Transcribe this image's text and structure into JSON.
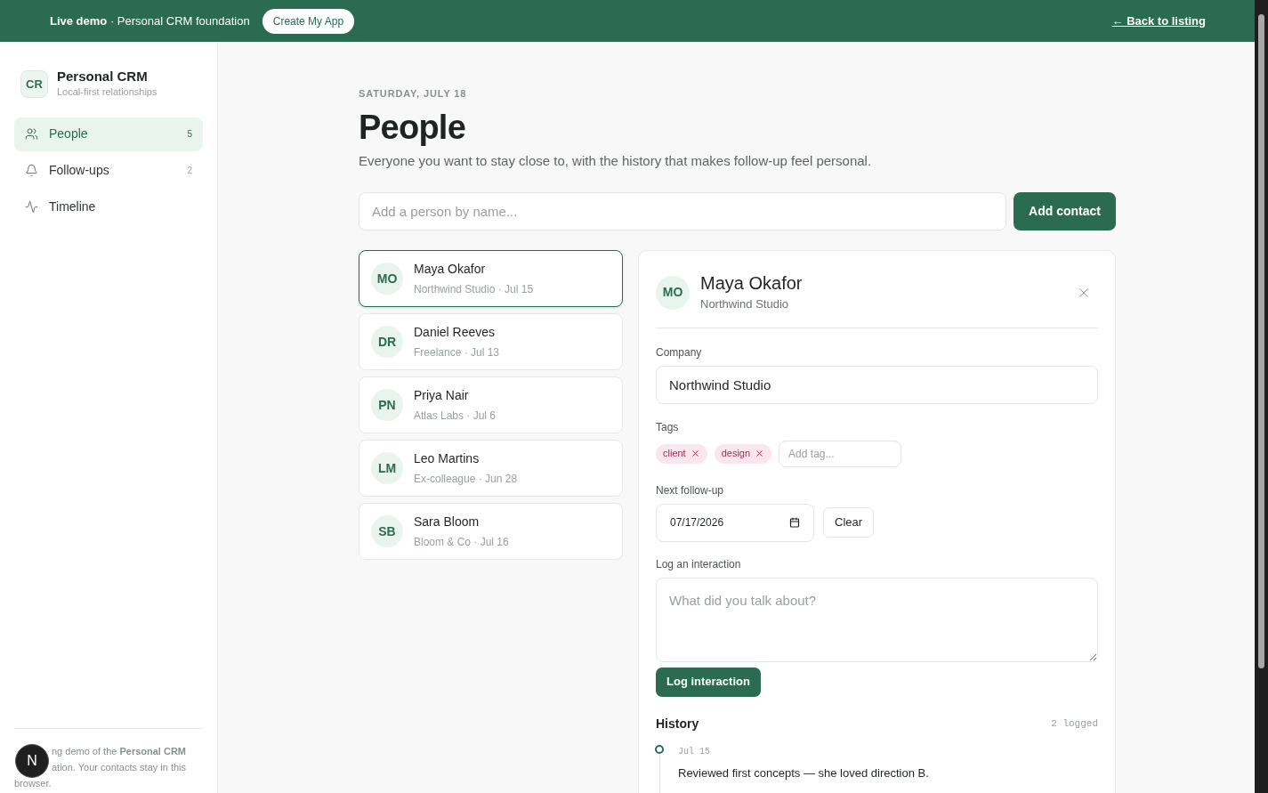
{
  "banner": {
    "text": "**Live demo** · Personal CRM foundation",
    "cta": "Create My App",
    "back_link": "← Back to listing"
  },
  "sidebar": {
    "logo": "CR",
    "title": "Personal CRM",
    "subtitle": "Local-first relationships",
    "items": [
      {
        "label": "People",
        "count": "5",
        "kind": "people",
        "selected": true
      },
      {
        "label": "Follow-ups",
        "count": "2",
        "kind": "bell",
        "selected": false
      },
      {
        "label": "Timeline",
        "kind": "pulse",
        "selected": false
      }
    ],
    "footer_lines": [
      "ng demo of the **Personal CRM**",
      "ation. Your contacts stay in this",
      "browser."
    ],
    "dev_badge": "N"
  },
  "page": {
    "date": "SATURDAY, JULY 18",
    "title": "People",
    "subtitle": "Everyone you want to stay close to, with the history that makes follow-up feel personal.",
    "add_placeholder": "Add a person by name...",
    "add_button": "Add contact"
  },
  "contacts": [
    {
      "initials": "MO",
      "name": "Maya Okafor",
      "meta": "Northwind Studio · Jul 15",
      "selected": true
    },
    {
      "initials": "DR",
      "name": "Daniel Reeves",
      "meta": "Freelance · Jul 13",
      "selected": false
    },
    {
      "initials": "PN",
      "name": "Priya Nair",
      "meta": "Atlas Labs · Jul 6",
      "selected": false
    },
    {
      "initials": "LM",
      "name": "Leo Martins",
      "meta": "Ex-colleague · Jun 28",
      "selected": false
    },
    {
      "initials": "SB",
      "name": "Sara Bloom",
      "meta": "Bloom & Co · Jul 16",
      "selected": false
    }
  ],
  "detail": {
    "initials": "MO",
    "name": "Maya Okafor",
    "company_sub": "Northwind Studio",
    "company_label": "Company",
    "company_value": "Northwind Studio",
    "tags_label": "Tags",
    "tags": [
      "client",
      "design"
    ],
    "tag_placeholder": "Add tag...",
    "followup_label": "Next follow-up",
    "followup_value": "07/17/2026",
    "clear_button": "Clear",
    "log_label": "Log an interaction",
    "log_placeholder": "What did you talk about?",
    "log_button": "Log interaction",
    "history_title": "History",
    "history_count": "2 logged",
    "history": [
      {
        "date": "Jul 15",
        "text": "Reviewed first concepts — she loved direction B."
      }
    ]
  }
}
